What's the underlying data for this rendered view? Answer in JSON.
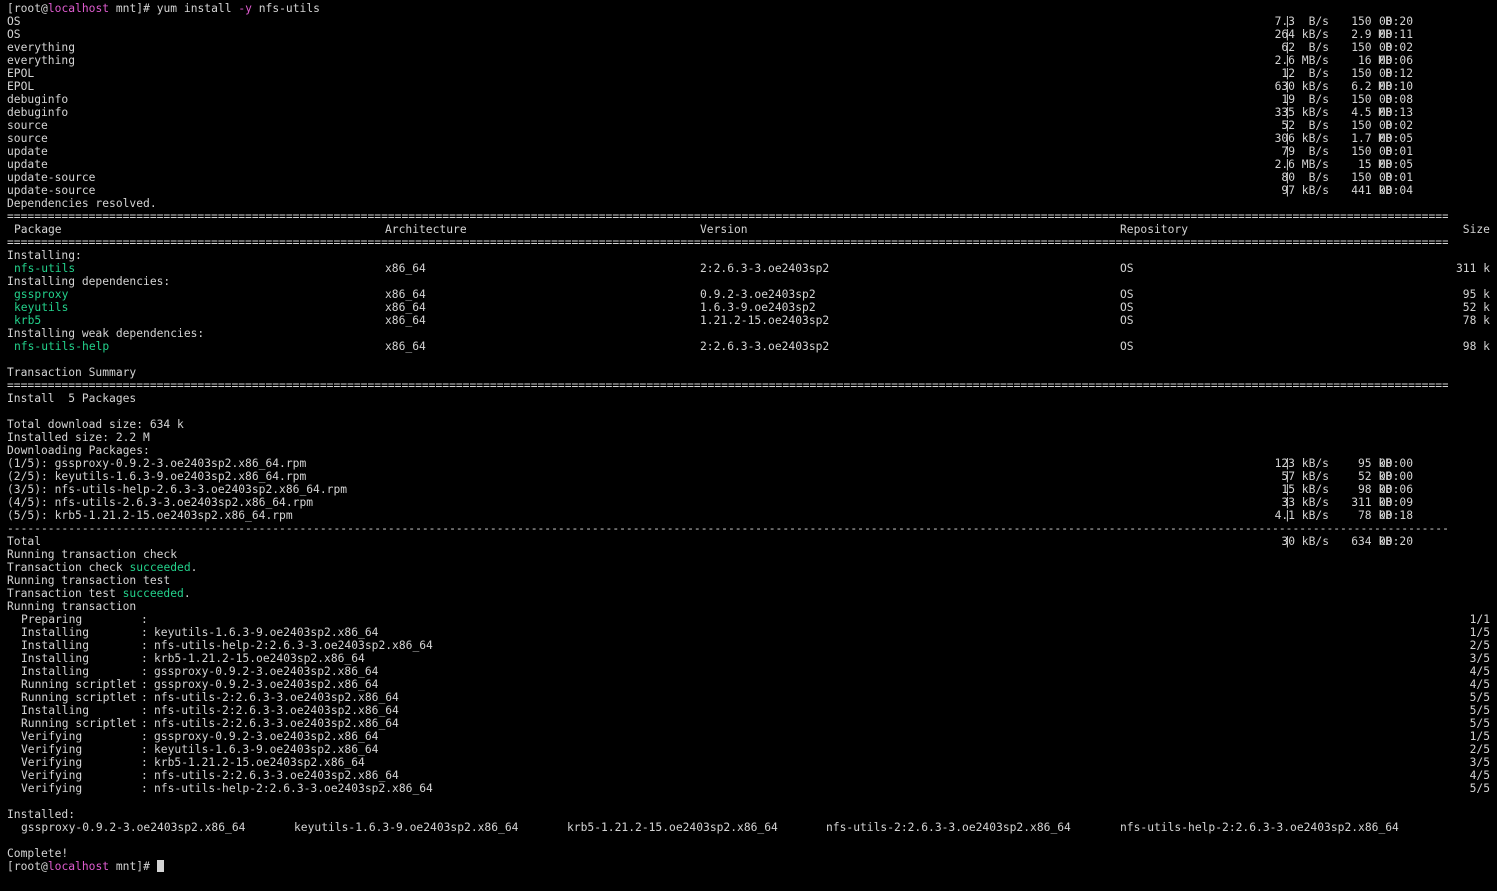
{
  "prompt": {
    "user": "root",
    "host": "localhost",
    "dir": "mnt"
  },
  "command": {
    "base": "yum install ",
    "opt": "-y",
    "rest": " nfs-utils"
  },
  "repo_syncs": [
    {
      "name": "OS",
      "rate": "7.3  B/s",
      "size": "150  B",
      "time": "00:20"
    },
    {
      "name": "OS",
      "rate": "264 kB/s",
      "size": "2.9 MB",
      "time": "00:11"
    },
    {
      "name": "everything",
      "rate": "62  B/s",
      "size": "150  B",
      "time": "00:02"
    },
    {
      "name": "everything",
      "rate": "2.6 MB/s",
      "size": " 16 MB",
      "time": "00:06"
    },
    {
      "name": "EPOL",
      "rate": "12  B/s",
      "size": "150  B",
      "time": "00:12"
    },
    {
      "name": "EPOL",
      "rate": "630 kB/s",
      "size": "6.2 MB",
      "time": "00:10"
    },
    {
      "name": "debuginfo",
      "rate": "19  B/s",
      "size": "150  B",
      "time": "00:08"
    },
    {
      "name": "debuginfo",
      "rate": "335 kB/s",
      "size": "4.5 MB",
      "time": "00:13"
    },
    {
      "name": "source",
      "rate": "52  B/s",
      "size": "150  B",
      "time": "00:02"
    },
    {
      "name": "source",
      "rate": "306 kB/s",
      "size": "1.7 MB",
      "time": "00:05"
    },
    {
      "name": "update",
      "rate": "79  B/s",
      "size": "150  B",
      "time": "00:01"
    },
    {
      "name": "update",
      "rate": "2.6 MB/s",
      "size": " 15 MB",
      "time": "00:05"
    },
    {
      "name": "update-source",
      "rate": "80  B/s",
      "size": "150  B",
      "time": "00:01"
    },
    {
      "name": "update-source",
      "rate": "97 kB/s",
      "size": "441 kB",
      "time": "00:04"
    }
  ],
  "deps_resolved": "Dependencies resolved.",
  "table": {
    "headers": {
      "package": "Package",
      "arch": "Architecture",
      "version": "Version",
      "repo": "Repository",
      "size": "Size"
    },
    "sections": [
      {
        "title": "Installing:",
        "rows": [
          {
            "pkg": "nfs-utils",
            "arch": "x86_64",
            "version": "2:2.6.3-3.oe2403sp2",
            "repo": "OS",
            "size": "311 k"
          }
        ]
      },
      {
        "title": "Installing dependencies:",
        "rows": [
          {
            "pkg": "gssproxy",
            "arch": "x86_64",
            "version": "0.9.2-3.oe2403sp2",
            "repo": "OS",
            "size": "95 k"
          },
          {
            "pkg": "keyutils",
            "arch": "x86_64",
            "version": "1.6.3-9.oe2403sp2",
            "repo": "OS",
            "size": "52 k"
          },
          {
            "pkg": "krb5",
            "arch": "x86_64",
            "version": "1.21.2-15.oe2403sp2",
            "repo": "OS",
            "size": "78 k"
          }
        ]
      },
      {
        "title": "Installing weak dependencies:",
        "rows": [
          {
            "pkg": "nfs-utils-help",
            "arch": "x86_64",
            "version": "2:2.6.3-3.oe2403sp2",
            "repo": "OS",
            "size": "98 k"
          }
        ]
      }
    ]
  },
  "summary": {
    "title": "Transaction Summary",
    "install": "Install  5 Packages",
    "total_download": "Total download size: 634 k",
    "installed_size": "Installed size: 2.2 M",
    "downloading": "Downloading Packages:"
  },
  "downloads": [
    {
      "name": "(1/5): gssproxy-0.9.2-3.oe2403sp2.x86_64.rpm",
      "rate": "123 kB/s",
      "size": " 95 kB",
      "time": "00:00"
    },
    {
      "name": "(2/5): keyutils-1.6.3-9.oe2403sp2.x86_64.rpm",
      "rate": "57 kB/s",
      "size": " 52 kB",
      "time": "00:00"
    },
    {
      "name": "(3/5): nfs-utils-help-2.6.3-3.oe2403sp2.x86_64.rpm",
      "rate": "15 kB/s",
      "size": " 98 kB",
      "time": "00:06"
    },
    {
      "name": "(4/5): nfs-utils-2.6.3-3.oe2403sp2.x86_64.rpm",
      "rate": "33 kB/s",
      "size": "311 kB",
      "time": "00:09"
    },
    {
      "name": "(5/5): krb5-1.21.2-15.oe2403sp2.x86_64.rpm",
      "rate": "4.1 kB/s",
      "size": " 78 kB",
      "time": "00:18"
    }
  ],
  "total": {
    "label": "Total",
    "rate": "30 kB/s",
    "size": "634 kB",
    "time": "00:20"
  },
  "transaction": {
    "check": "Running transaction check",
    "check_ok_prefix": "Transaction check ",
    "test": "Running transaction test",
    "test_ok_prefix": "Transaction test ",
    "succeeded": "succeeded",
    "dot": ".",
    "running": "Running transaction"
  },
  "steps": [
    {
      "action": "Preparing",
      "pkg": "",
      "progress": "1/1"
    },
    {
      "action": "Installing",
      "pkg": "keyutils-1.6.3-9.oe2403sp2.x86_64",
      "progress": "1/5"
    },
    {
      "action": "Installing",
      "pkg": "nfs-utils-help-2:2.6.3-3.oe2403sp2.x86_64",
      "progress": "2/5"
    },
    {
      "action": "Installing",
      "pkg": "krb5-1.21.2-15.oe2403sp2.x86_64",
      "progress": "3/5"
    },
    {
      "action": "Installing",
      "pkg": "gssproxy-0.9.2-3.oe2403sp2.x86_64",
      "progress": "4/5"
    },
    {
      "action": "Running scriptlet",
      "pkg": "gssproxy-0.9.2-3.oe2403sp2.x86_64",
      "progress": "4/5"
    },
    {
      "action": "Running scriptlet",
      "pkg": "nfs-utils-2:2.6.3-3.oe2403sp2.x86_64",
      "progress": "5/5"
    },
    {
      "action": "Installing",
      "pkg": "nfs-utils-2:2.6.3-3.oe2403sp2.x86_64",
      "progress": "5/5"
    },
    {
      "action": "Running scriptlet",
      "pkg": "nfs-utils-2:2.6.3-3.oe2403sp2.x86_64",
      "progress": "5/5"
    },
    {
      "action": "Verifying",
      "pkg": "gssproxy-0.9.2-3.oe2403sp2.x86_64",
      "progress": "1/5"
    },
    {
      "action": "Verifying",
      "pkg": "keyutils-1.6.3-9.oe2403sp2.x86_64",
      "progress": "2/5"
    },
    {
      "action": "Verifying",
      "pkg": "krb5-1.21.2-15.oe2403sp2.x86_64",
      "progress": "3/5"
    },
    {
      "action": "Verifying",
      "pkg": "nfs-utils-2:2.6.3-3.oe2403sp2.x86_64",
      "progress": "4/5"
    },
    {
      "action": "Verifying",
      "pkg": "nfs-utils-help-2:2.6.3-3.oe2403sp2.x86_64",
      "progress": "5/5"
    }
  ],
  "installed": {
    "label": "Installed:",
    "packages": [
      "gssproxy-0.9.2-3.oe2403sp2.x86_64",
      "keyutils-1.6.3-9.oe2403sp2.x86_64",
      "krb5-1.21.2-15.oe2403sp2.x86_64",
      "nfs-utils-2:2.6.3-3.oe2403sp2.x86_64",
      "nfs-utils-help-2:2.6.3-3.oe2403sp2.x86_64"
    ]
  },
  "complete": "Complete!",
  "colors": {
    "background": "#000000",
    "text": "#d4d4d4",
    "package": "#23d18b",
    "host": "#e05cd0"
  },
  "icons": {
    "cursor": "block-cursor-icon"
  }
}
